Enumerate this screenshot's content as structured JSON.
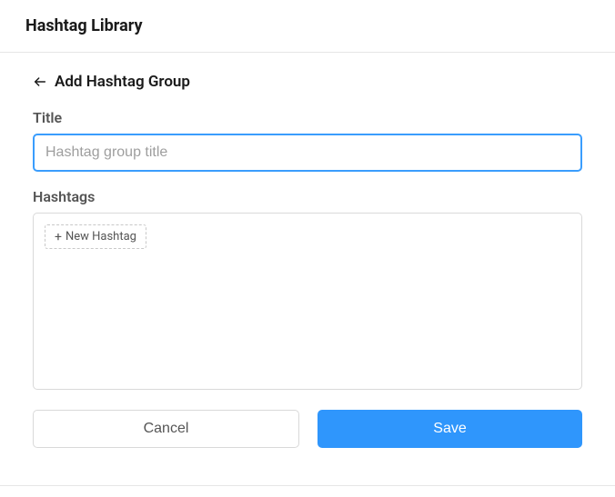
{
  "header": {
    "title": "Hashtag Library"
  },
  "form": {
    "back_label": "Add Hashtag Group",
    "title_label": "Title",
    "title_placeholder": "Hashtag group title",
    "title_value": "",
    "hashtags_label": "Hashtags",
    "new_hashtag_label": "New Hashtag"
  },
  "buttons": {
    "cancel": "Cancel",
    "save": "Save"
  },
  "colors": {
    "accent": "#2f96fc",
    "focus_border": "#3a9dfd"
  }
}
